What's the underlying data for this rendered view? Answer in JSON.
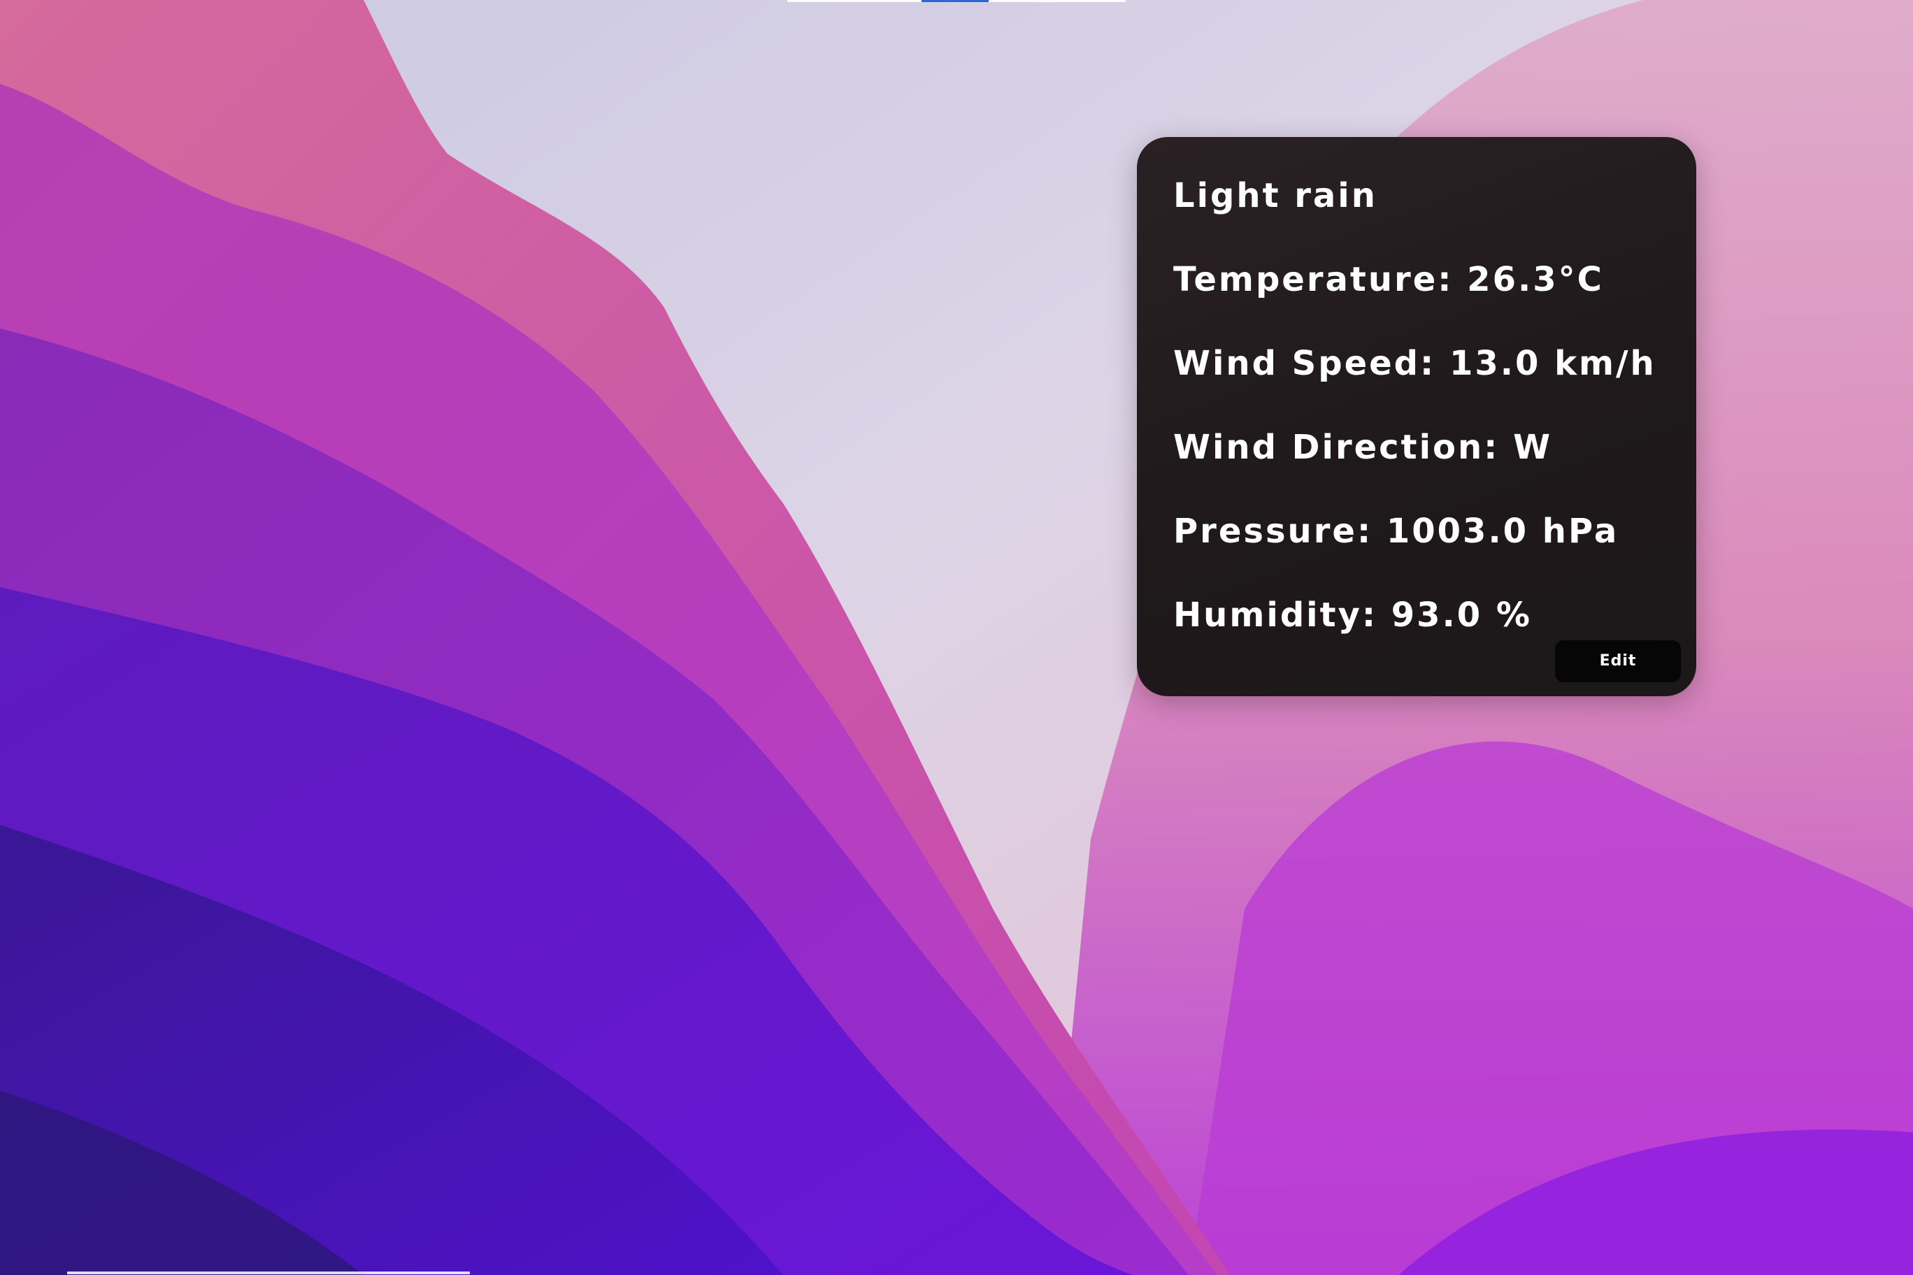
{
  "weather_widget": {
    "condition": "Light rain",
    "temperature": "Temperature: 26.3°C",
    "wind_speed": "Wind Speed: 13.0 km/h",
    "wind_direction": "Wind Direction: W",
    "pressure": "Pressure: 1003.0 hPa",
    "humidity": "Humidity: 93.0 %",
    "edit_label": "Edit"
  },
  "colors": {
    "widget_background": "#211b1d",
    "text": "#ffffff",
    "edit_button": "#070606",
    "wallpaper_purple": "#5a16c8",
    "wallpaper_magenta": "#c43fb0",
    "wallpaper_light": "#d7d3e6"
  }
}
